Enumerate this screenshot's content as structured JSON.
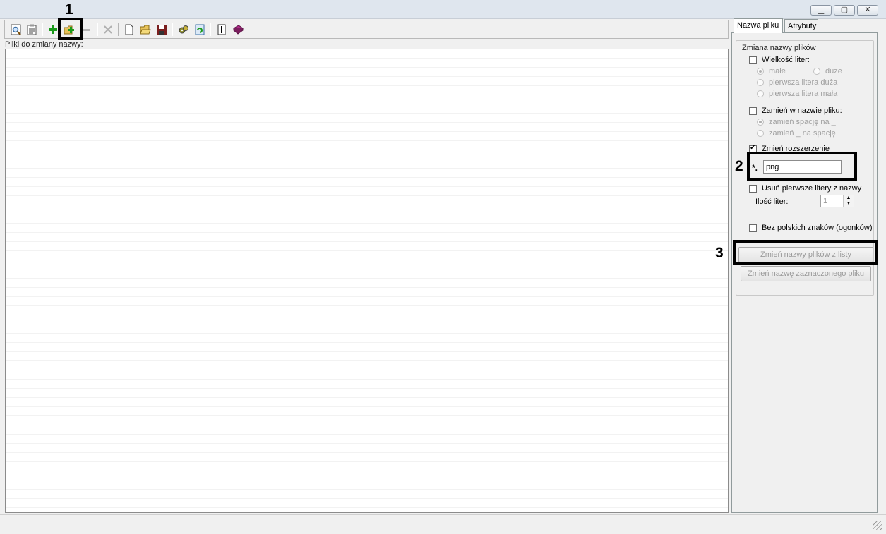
{
  "toolbar": {
    "icons": [
      "preview-icon",
      "notes-icon",
      "add-file-icon",
      "add-folder-icon",
      "remove-icon",
      "delete-icon",
      "new-icon",
      "open-icon",
      "save-icon",
      "settings-icon",
      "refresh-icon",
      "info-icon",
      "help-book-icon"
    ]
  },
  "files": {
    "label": "Pliki do zmiany nazwy:"
  },
  "tabs": [
    {
      "label": "Nazwa pliku"
    },
    {
      "label": "Atrybuty"
    }
  ],
  "rename": {
    "group_title": "Zmiana nazwy plików",
    "case": {
      "label": "Wielkość liter:",
      "checked": false,
      "options": [
        "małe",
        "duże",
        "pierwsza litera duża",
        "pierwsza litera mała"
      ],
      "selected": "małe"
    },
    "replace": {
      "label": "Zamień w nazwie pliku:",
      "checked": false,
      "options": [
        "zamień spację na _",
        "zamień _ na spację"
      ],
      "selected": "zamień spację na _"
    },
    "extension": {
      "label": "Zmień rozszerzenie",
      "checked": true,
      "prefix": "*.",
      "value": "png"
    },
    "remove_first": {
      "label": "Usuń pierwsze litery z nazwy",
      "checked": false,
      "count_label": "Ilość liter:",
      "count_value": "1"
    },
    "no_polish": {
      "label": "Bez polskich znaków (ogonków)",
      "checked": false
    },
    "buttons": {
      "rename_list": "Zmień nazwy plików z listy",
      "rename_selected": "Zmień nazwę zaznaczonego pliku"
    }
  },
  "annotations": [
    "1",
    "2",
    "3"
  ]
}
